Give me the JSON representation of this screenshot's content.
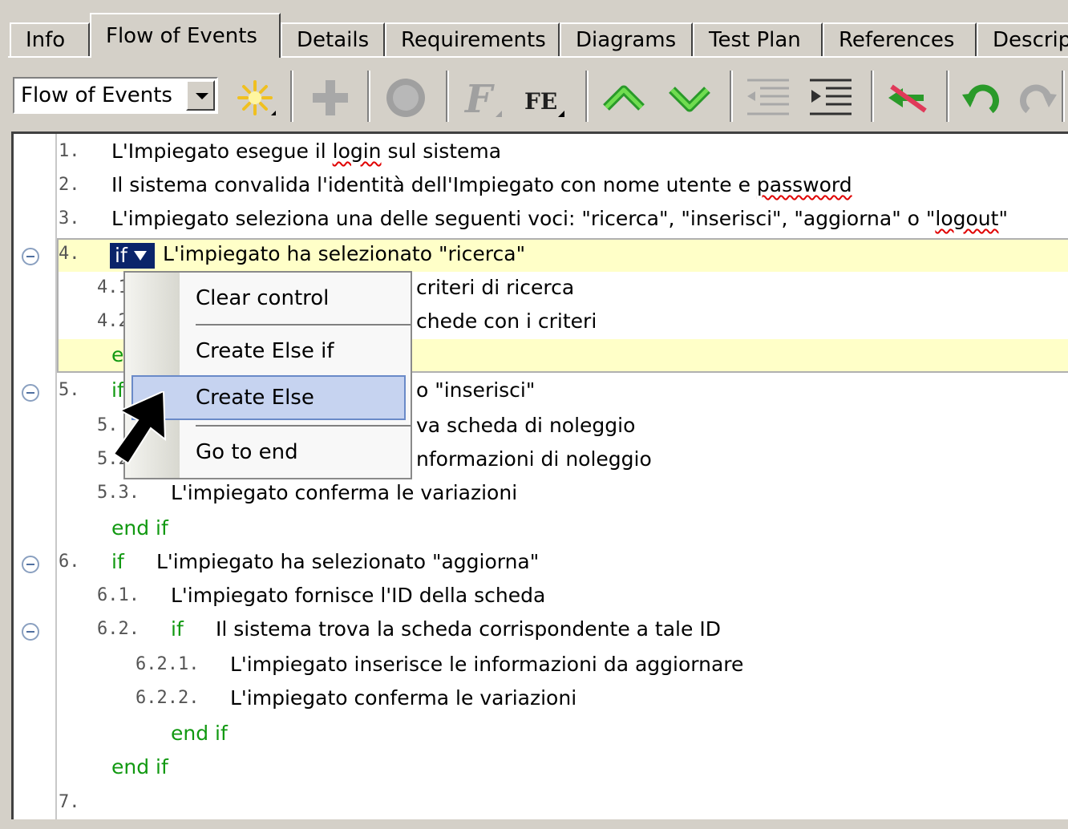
{
  "tabs": [
    {
      "label": "Info"
    },
    {
      "label": "Flow of Events"
    },
    {
      "label": "Details"
    },
    {
      "label": "Requirements"
    },
    {
      "label": "Diagrams"
    },
    {
      "label": "Test Plan"
    },
    {
      "label": "References"
    },
    {
      "label": "Descrip"
    }
  ],
  "toolbar": {
    "combo_value": "Flow of Events",
    "icons": [
      "new-step-icon",
      "add-icon",
      "record-icon",
      "italic-f-icon",
      "format-fe-icon",
      "move-up-icon",
      "move-down-icon",
      "outdent-icon",
      "indent-icon",
      "remove-icon",
      "undo-icon",
      "redo-icon"
    ]
  },
  "colors": {
    "keyword": "#119911",
    "highlight": "#ffffc8",
    "selection": "#0a246a"
  },
  "editor": {
    "lines": [
      {
        "num": "1.",
        "text_before": "L'Impiegato esegue il ",
        "squig": "login",
        "text_after": " sul sistema"
      },
      {
        "num": "2.",
        "text_before": "Il sistema convalida l'identità dell'Impiegato con nome utente e ",
        "squig": "password",
        "text_after": ""
      },
      {
        "num": "3.",
        "text_before": "L'impiegato seleziona una delle seguenti voci:  \"ricerca\", \"inserisci\", \"aggiorna\" o \"",
        "squig": "logout",
        "text_after": "\""
      },
      {
        "num": "4.",
        "kw": "if",
        "text": "L'impiegato ha selezionato \"ricerca\""
      },
      {
        "num": "4.1",
        "text": "criteri di ricerca"
      },
      {
        "num": "4.2",
        "text": "chede con i criteri"
      },
      {
        "kw": "e"
      },
      {
        "num": "5.",
        "kw": "if",
        "text": "o \"inserisci\""
      },
      {
        "num": "5.",
        "text": "va scheda di noleggio"
      },
      {
        "num": "5.2",
        "text": "nformazioni di noleggio"
      },
      {
        "num": "5.3.",
        "text": "L'impiegato conferma le variazioni"
      },
      {
        "kw": "end if"
      },
      {
        "num": "6.",
        "kw": "if",
        "text": "L'impiegato ha selezionato \"aggiorna\""
      },
      {
        "num": "6.1.",
        "text": "L'impiegato fornisce l'ID della scheda"
      },
      {
        "num": "6.2.",
        "kw": "if",
        "text": "Il sistema trova la scheda corrispondente a tale ID"
      },
      {
        "num": "6.2.1.",
        "text": "L'impiegato inserisce le informazioni da aggiornare"
      },
      {
        "num": "6.2.2.",
        "text": "L'impiegato conferma le variazioni"
      },
      {
        "kw": "end if"
      },
      {
        "kw": "end if"
      },
      {
        "num": "7."
      }
    ],
    "selected_keyword": "if"
  },
  "context_menu": {
    "items": [
      "Clear control",
      "Create Else if",
      "Create Else",
      "Go to end"
    ],
    "highlighted": "Create Else"
  }
}
